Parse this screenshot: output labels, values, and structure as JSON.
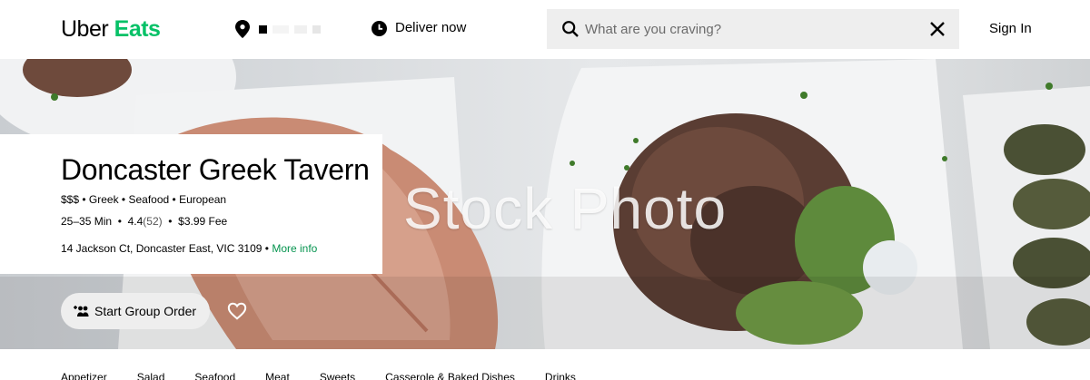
{
  "header": {
    "logo_primary": "Uber",
    "logo_accent": "Eats",
    "location_icon": "location-pin-icon",
    "deliver_label": "Deliver now",
    "deliver_icon": "clock-icon",
    "search": {
      "placeholder": "What are you craving?",
      "value": "",
      "search_icon": "search-icon",
      "clear_icon": "close-icon"
    },
    "sign_in_label": "Sign In"
  },
  "hero": {
    "watermark": "Stock Photo"
  },
  "store": {
    "name": "Doncaster Greek Tavern",
    "price": "$$$",
    "cuisines": [
      "Greek",
      "Seafood",
      "European"
    ],
    "delivery_time": "25–35 Min",
    "rating": "4.4",
    "rating_count": "(52)",
    "fee": "$3.99 Fee",
    "address": "14 Jackson Ct, Doncaster East, VIC 3109",
    "more_info_label": "More info"
  },
  "actions": {
    "group_order_label": "Start Group Order",
    "group_order_icon": "add-group-icon",
    "favorite_icon": "heart-icon"
  },
  "categories": [
    "Appetizer",
    "Salad",
    "Seafood",
    "Meat",
    "Sweets",
    "Casserole & Baked Dishes",
    "Drinks"
  ],
  "colors": {
    "brand_green": "#06c167",
    "link_green": "#05944f",
    "search_bg": "#eeeeee"
  }
}
